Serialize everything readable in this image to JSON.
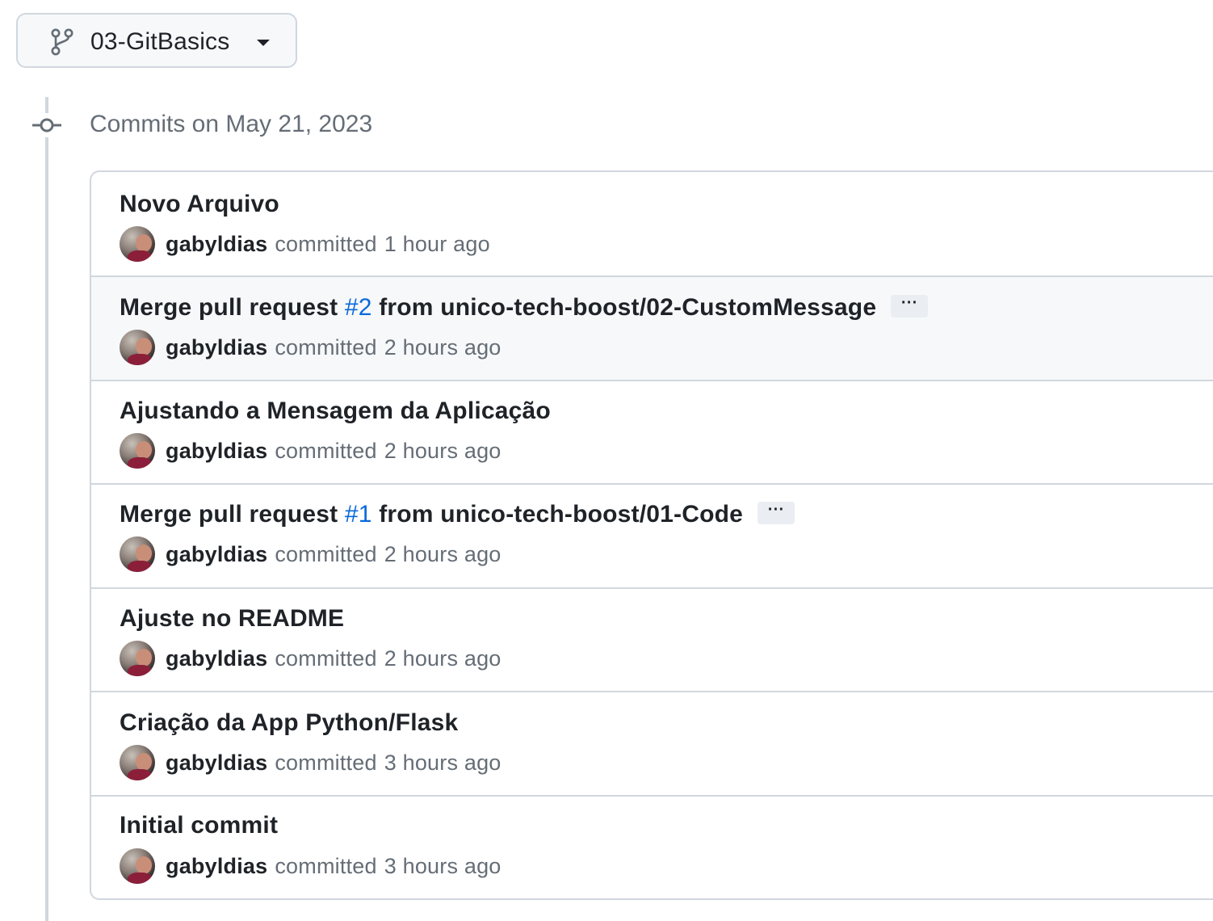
{
  "branch": {
    "name": "03-GitBasics"
  },
  "timeline": {
    "date_header": "Commits on May 21, 2023"
  },
  "commits": [
    {
      "title": "Novo Arquivo",
      "author": "gabyldias",
      "action": "committed",
      "time": "1 hour ago"
    },
    {
      "title_prefix": "Merge pull request",
      "pr_link": "#2",
      "title_suffix": "from unico-tech-boost/02-CustomMessage",
      "ellipsis": "···",
      "author": "gabyldias",
      "action": "committed",
      "time": "2 hours ago"
    },
    {
      "title": "Ajustando a Mensagem da Aplicação",
      "author": "gabyldias",
      "action": "committed",
      "time": "2 hours ago"
    },
    {
      "title_prefix": "Merge pull request",
      "pr_link": "#1",
      "title_suffix": "from unico-tech-boost/01-Code",
      "ellipsis": "···",
      "author": "gabyldias",
      "action": "committed",
      "time": "2 hours ago"
    },
    {
      "title": "Ajuste no README",
      "author": "gabyldias",
      "action": "committed",
      "time": "2 hours ago"
    },
    {
      "title": "Criação da App Python/Flask",
      "author": "gabyldias",
      "action": "committed",
      "time": "3 hours ago"
    },
    {
      "title": "Initial commit",
      "author": "gabyldias",
      "action": "committed",
      "time": "3 hours ago"
    }
  ],
  "colors": {
    "link": "#0969da",
    "muted": "#656d76",
    "border": "#d0d7de",
    "hover_bg": "#f6f8fa"
  }
}
